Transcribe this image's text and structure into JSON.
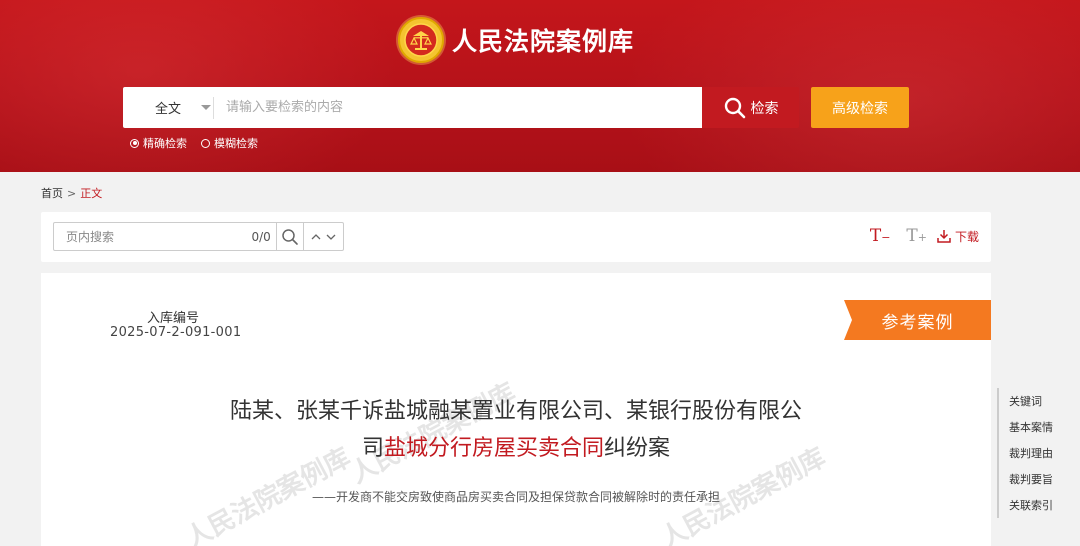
{
  "header": {
    "site_title": "人民法院案例库",
    "emblem_icon": "court-emblem-icon",
    "search": {
      "scope_selected": "全文",
      "placeholder": "请输入要检索的内容",
      "search_label": "检索",
      "advanced_label": "高级检索",
      "modes": [
        {
          "label": "精确检索",
          "selected": true
        },
        {
          "label": "模糊检索",
          "selected": false
        }
      ]
    }
  },
  "breadcrumb": {
    "home": "首页",
    "separator": ">",
    "current": "正文"
  },
  "toolbar": {
    "in_page_placeholder": "页内搜索",
    "match_count": "0/0",
    "font_decrease": "T",
    "font_decrease_sign": "−",
    "font_increase": "T",
    "font_increase_sign": "+",
    "download_label": "下载"
  },
  "document": {
    "case_no_label": "入库编号",
    "case_no_value": "2025-07-2-091-001",
    "ref_tag": "参考案例",
    "title_part1": "陆某、张某千诉盐城融某置业有限公司、某银行股份有限公",
    "title_part2": "司",
    "title_highlight": "盐城分行房屋买卖合同",
    "title_part3": "纠纷案",
    "subtitle": "——开发商不能交房致使商品房买卖合同及担保贷款合同被解除时的责任承担",
    "watermark": "人民法院案例库"
  },
  "sidenav": {
    "items": [
      "关键词",
      "基本案情",
      "裁判理由",
      "裁判要旨",
      "关联索引"
    ]
  },
  "colors": {
    "brand_red": "#c21a20",
    "accent_orange": "#f7a21a",
    "tag_orange": "#f47920"
  }
}
